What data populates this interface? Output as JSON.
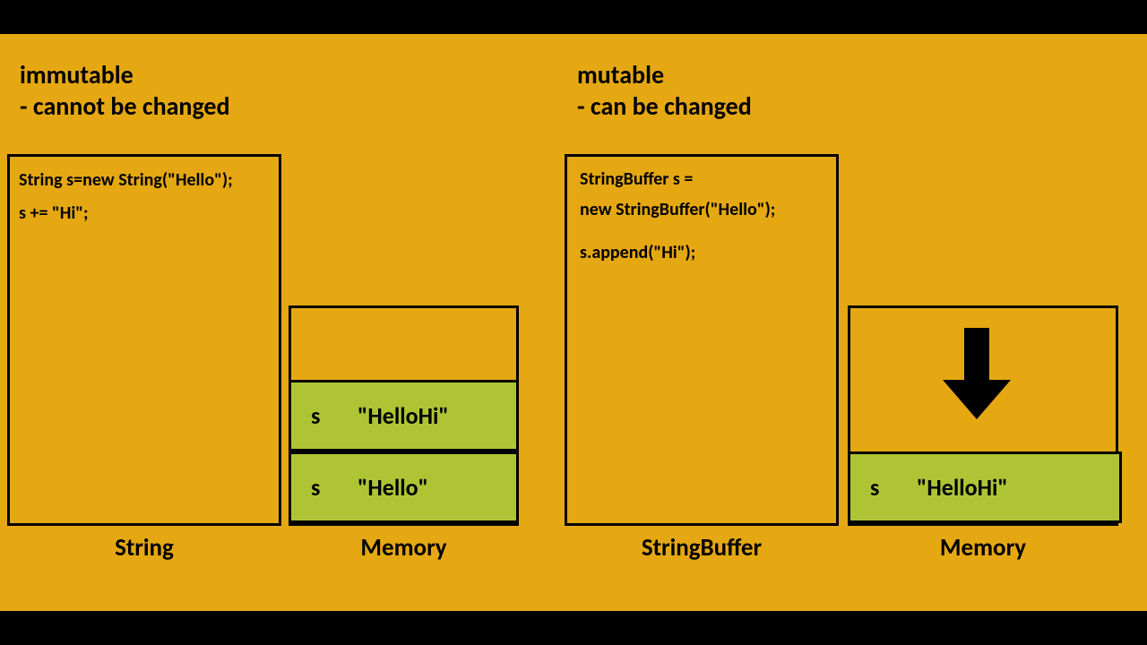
{
  "left": {
    "heading_line1": "immutable",
    "heading_line2": "- cannot be changed",
    "code_line1": "String s=new String(\"Hello\");",
    "code_line2": " s += \"Hi\";",
    "box_label": "String",
    "memory_label": "Memory",
    "cell1_var": "s",
    "cell1_val": "\"HelloHi\"",
    "cell2_var": "s",
    "cell2_val": "\"Hello\""
  },
  "right": {
    "heading_line1": "mutable",
    "heading_line2": "- can be changed",
    "code_line1": "StringBuffer s =",
    "code_line2": "new StringBuffer(\"Hello\");",
    "code_line3": " s.append(\"Hi\");",
    "box_label": "StringBuffer",
    "memory_label": "Memory",
    "cell_var": "s",
    "cell_val": "\"HelloHi\""
  }
}
